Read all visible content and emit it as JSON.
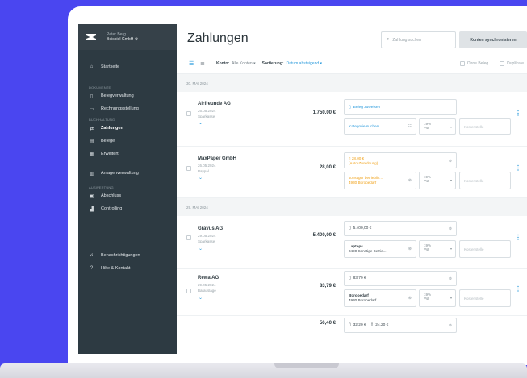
{
  "colors": {
    "accent": "#2b9bdc",
    "background": "#4a46f0",
    "sidebar": "#2d3a42",
    "warning": "#f0a21a"
  },
  "brand": {
    "user": "Peter Berg",
    "company": "Beispiel GmbH",
    "company_icon": "gear-icon"
  },
  "sidebar": {
    "home": "Startseite",
    "sections": {
      "documents": "DOKUMENTE",
      "bookkeeping": "BUCHHALTUNG",
      "evaluation": "AUSWERTUNG"
    },
    "items": {
      "receipts_mgmt": "Belegverwaltung",
      "invoicing": "Rechnungsstellung",
      "payments": "Zahlungen",
      "receipts": "Belege",
      "advanced": "Erweitert",
      "assets": "Anlagenverwaltung",
      "closing": "Abschluss",
      "controlling": "Controlling",
      "notifications": "Benachrichtigungen",
      "help": "Hilfe & Kontakt"
    }
  },
  "header": {
    "title": "Zahlungen",
    "search_placeholder": "Zahlung suchen",
    "sync_button": "Konten synchronisieren"
  },
  "toolbar": {
    "account_label": "Konto:",
    "account_value": "Alle Konten",
    "sort_label": "Sortierung:",
    "sort_value": "Datum absteigend",
    "filter_no_receipt": "Ohne Beleg",
    "filter_duplicates": "Duplikate"
  },
  "date_groups": [
    "30. MAI 2024",
    "29. MAI 2024"
  ],
  "payments": [
    {
      "name": "Airfreunde AG",
      "date": "26.05.2024",
      "account": "Sparkasse",
      "amount": "1.750,00 €",
      "receipt": "Beleg zuweisen",
      "category": "Kategorie suchen",
      "vat": "19%",
      "vat_sub": "Vst",
      "cost_center": "Kostenstelle"
    },
    {
      "name": "MaxPaper GmbH",
      "date": "26.05.2024",
      "account": "Paypal",
      "amount": "28,00 €",
      "receipt_amount": "28,00 €",
      "receipt_note": "(Auto-Zuordnung)",
      "category_title": "sonstiger betrieblic...",
      "category_code": "4930  Bürobedarf",
      "vat": "19%",
      "vat_sub": "Vst",
      "cost_center": "Kostenstelle"
    },
    {
      "name": "Gravus AG",
      "date": "29.05.2024",
      "account": "Sparkasse",
      "amount": "5.400,00 €",
      "receipt_amount": "5.400,00 €",
      "category_title": "Laptops",
      "category_code": "0490  Sonstige Betrie...",
      "vat": "19%",
      "vat_sub": "Vst",
      "cost_center": "Kostenstelle"
    },
    {
      "name": "Rewa AG",
      "date": "29.05.2024",
      "account": "Barauslage",
      "amount": "83,79 €",
      "receipt_amount": "83,79 €",
      "category_title": "Bürobedarf",
      "category_code": "4930  Bürobedarf",
      "vat": "19%",
      "vat_sub": "Vst",
      "cost_center": "Kostenstelle"
    },
    {
      "amount": "56,40 €",
      "receipt_a": "32,20 €",
      "receipt_b": "24,20 €"
    }
  ]
}
